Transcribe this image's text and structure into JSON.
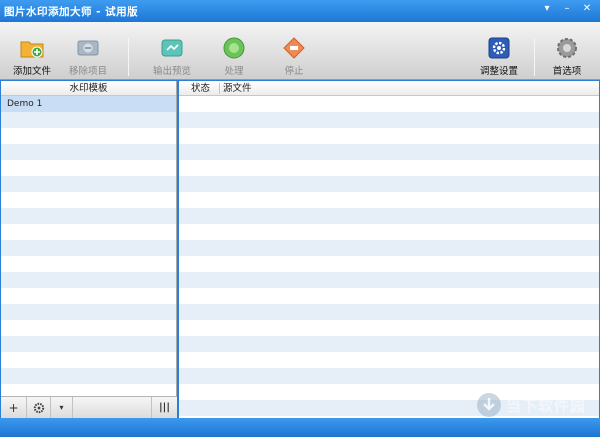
{
  "window": {
    "title": "图片水印添加大师 - 试用版"
  },
  "window_buttons": [
    "▾",
    "–",
    "✕"
  ],
  "toolbar": {
    "add_file": "添加文件",
    "remove_item": "移除项目",
    "output_preview": "输出预览",
    "process": "处理",
    "stop": "停止",
    "adjust_settings": "调整设置",
    "preferences": "首选项"
  },
  "left_panel": {
    "header": "水印模板",
    "items": [
      "Demo 1"
    ]
  },
  "right_panel": {
    "columns": [
      "状态",
      "源文件"
    ]
  },
  "bottom_bar": {
    "add": "+",
    "dropdown": "▾",
    "columns_toggle": "|||"
  },
  "watermark": {
    "text": "当下软件园"
  },
  "colors": {
    "title_bar": "#1f77d6",
    "selection": "#c9def5",
    "stripe": "#e6eef8"
  }
}
